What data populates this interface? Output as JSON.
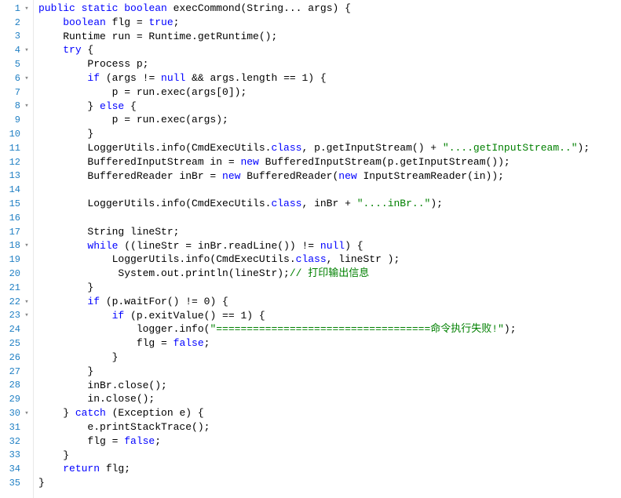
{
  "lines": [
    {
      "n": 1,
      "fold": "▾",
      "tokens": [
        [
          "kw",
          "public"
        ],
        [
          "",
          " "
        ],
        [
          "kw",
          "static"
        ],
        [
          "",
          " "
        ],
        [
          "kw",
          "boolean"
        ],
        [
          "",
          " execCommond(String... args) {"
        ]
      ]
    },
    {
      "n": 2,
      "fold": "",
      "tokens": [
        [
          "",
          "    "
        ],
        [
          "kw",
          "boolean"
        ],
        [
          "",
          " flg = "
        ],
        [
          "kw",
          "true"
        ],
        [
          "",
          ";"
        ]
      ]
    },
    {
      "n": 3,
      "fold": "",
      "tokens": [
        [
          "",
          "    Runtime run = Runtime.getRuntime();"
        ]
      ]
    },
    {
      "n": 4,
      "fold": "▾",
      "tokens": [
        [
          "",
          "    "
        ],
        [
          "kw",
          "try"
        ],
        [
          "",
          " {"
        ]
      ]
    },
    {
      "n": 5,
      "fold": "",
      "tokens": [
        [
          "",
          "        Process p;"
        ]
      ]
    },
    {
      "n": 6,
      "fold": "▾",
      "tokens": [
        [
          "",
          "        "
        ],
        [
          "kw",
          "if"
        ],
        [
          "",
          " (args != "
        ],
        [
          "kw",
          "null"
        ],
        [
          "",
          " && args.length == 1) {"
        ]
      ]
    },
    {
      "n": 7,
      "fold": "",
      "tokens": [
        [
          "",
          "            p = run.exec(args[0]);"
        ]
      ]
    },
    {
      "n": 8,
      "fold": "▾",
      "tokens": [
        [
          "",
          "        } "
        ],
        [
          "kw",
          "else"
        ],
        [
          "",
          " {"
        ]
      ]
    },
    {
      "n": 9,
      "fold": "",
      "tokens": [
        [
          "",
          "            p = run.exec(args);"
        ]
      ]
    },
    {
      "n": 10,
      "fold": "",
      "tokens": [
        [
          "",
          "        }"
        ]
      ]
    },
    {
      "n": 11,
      "fold": "",
      "tokens": [
        [
          "",
          "        LoggerUtils.info(CmdExecUtils."
        ],
        [
          "kw",
          "class"
        ],
        [
          "",
          ", p.getInputStream() + "
        ],
        [
          "str",
          "\"....getInputStream..\""
        ],
        [
          "",
          ");"
        ]
      ]
    },
    {
      "n": 12,
      "fold": "",
      "tokens": [
        [
          "",
          "        BufferedInputStream in = "
        ],
        [
          "kw",
          "new"
        ],
        [
          "",
          " BufferedInputStream(p.getInputStream());"
        ]
      ]
    },
    {
      "n": 13,
      "fold": "",
      "tokens": [
        [
          "",
          "        BufferedReader inBr = "
        ],
        [
          "kw",
          "new"
        ],
        [
          "",
          " BufferedReader("
        ],
        [
          "kw",
          "new"
        ],
        [
          "",
          " InputStreamReader(in));"
        ]
      ]
    },
    {
      "n": 14,
      "fold": "",
      "tokens": [
        [
          "",
          ""
        ]
      ]
    },
    {
      "n": 15,
      "fold": "",
      "tokens": [
        [
          "",
          "        LoggerUtils.info(CmdExecUtils."
        ],
        [
          "kw",
          "class"
        ],
        [
          "",
          ", inBr + "
        ],
        [
          "str",
          "\"....inBr..\""
        ],
        [
          "",
          ");"
        ]
      ]
    },
    {
      "n": 16,
      "fold": "",
      "tokens": [
        [
          "",
          ""
        ]
      ]
    },
    {
      "n": 17,
      "fold": "",
      "tokens": [
        [
          "",
          "        String lineStr;"
        ]
      ]
    },
    {
      "n": 18,
      "fold": "▾",
      "tokens": [
        [
          "",
          "        "
        ],
        [
          "kw",
          "while"
        ],
        [
          "",
          " ((lineStr = inBr.readLine()) != "
        ],
        [
          "kw",
          "null"
        ],
        [
          "",
          ") {"
        ]
      ]
    },
    {
      "n": 19,
      "fold": "",
      "tokens": [
        [
          "",
          "            LoggerUtils.info(CmdExecUtils."
        ],
        [
          "kw",
          "class"
        ],
        [
          "",
          ", lineStr );"
        ]
      ]
    },
    {
      "n": 20,
      "fold": "",
      "tokens": [
        [
          "",
          "             System.out.println(lineStr);"
        ],
        [
          "cm",
          "// 打印输出信息"
        ]
      ]
    },
    {
      "n": 21,
      "fold": "",
      "tokens": [
        [
          "",
          "        }"
        ]
      ]
    },
    {
      "n": 22,
      "fold": "▾",
      "tokens": [
        [
          "",
          "        "
        ],
        [
          "kw",
          "if"
        ],
        [
          "",
          " (p.waitFor() != 0) {"
        ]
      ]
    },
    {
      "n": 23,
      "fold": "▾",
      "tokens": [
        [
          "",
          "            "
        ],
        [
          "kw",
          "if"
        ],
        [
          "",
          " (p.exitValue() == 1) {"
        ]
      ]
    },
    {
      "n": 24,
      "fold": "",
      "tokens": [
        [
          "",
          "                logger.info("
        ],
        [
          "str",
          "\"===================================命令执行失败!\""
        ],
        [
          "",
          ");"
        ]
      ]
    },
    {
      "n": 25,
      "fold": "",
      "tokens": [
        [
          "",
          "                flg = "
        ],
        [
          "kw",
          "false"
        ],
        [
          "",
          ";"
        ]
      ]
    },
    {
      "n": 26,
      "fold": "",
      "tokens": [
        [
          "",
          "            }"
        ]
      ]
    },
    {
      "n": 27,
      "fold": "",
      "tokens": [
        [
          "",
          "        }"
        ]
      ]
    },
    {
      "n": 28,
      "fold": "",
      "tokens": [
        [
          "",
          "        inBr.close();"
        ]
      ]
    },
    {
      "n": 29,
      "fold": "",
      "tokens": [
        [
          "",
          "        in.close();"
        ]
      ]
    },
    {
      "n": 30,
      "fold": "▾",
      "tokens": [
        [
          "",
          "    } "
        ],
        [
          "kw",
          "catch"
        ],
        [
          "",
          " (Exception e) {"
        ]
      ]
    },
    {
      "n": 31,
      "fold": "",
      "tokens": [
        [
          "",
          "        e.printStackTrace();"
        ]
      ]
    },
    {
      "n": 32,
      "fold": "",
      "tokens": [
        [
          "",
          "        flg = "
        ],
        [
          "kw",
          "false"
        ],
        [
          "",
          ";"
        ]
      ]
    },
    {
      "n": 33,
      "fold": "",
      "tokens": [
        [
          "",
          "    }"
        ]
      ]
    },
    {
      "n": 34,
      "fold": "",
      "tokens": [
        [
          "",
          "    "
        ],
        [
          "kw",
          "return"
        ],
        [
          "",
          " flg;"
        ]
      ]
    },
    {
      "n": 35,
      "fold": "",
      "tokens": [
        [
          "",
          "}"
        ]
      ]
    }
  ]
}
